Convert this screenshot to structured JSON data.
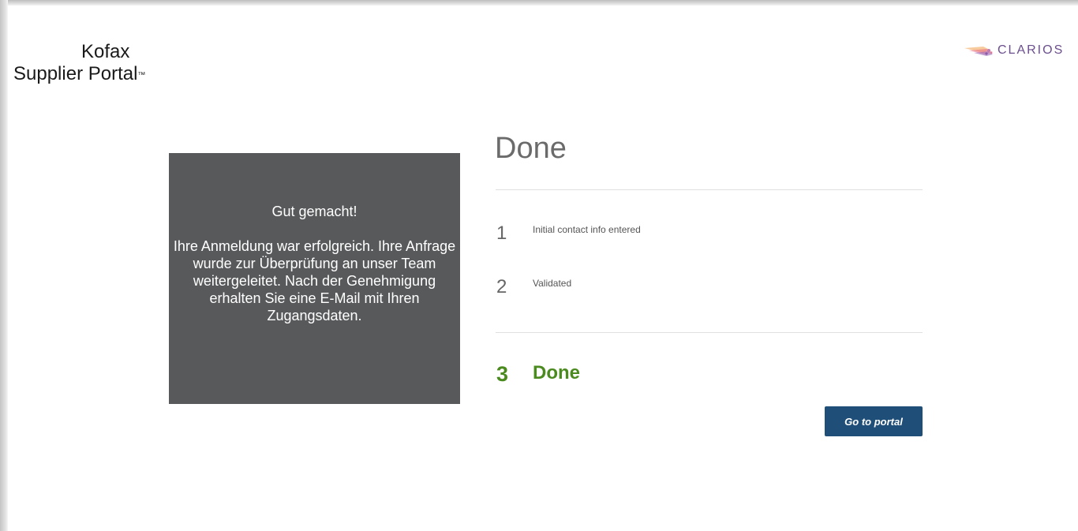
{
  "header": {
    "logo_line1": "Kofax",
    "logo_line2": "Supplier Portal",
    "logo_tm": "™",
    "brand_name": "CLARIOS",
    "brand_color": "#6b4f8e"
  },
  "message": {
    "title": "Gut gemacht!",
    "body": "Ihre Anmeldung war erfolgreich. Ihre Anfrage wurde zur Überprüfung an unser Team weitergeleitet. Nach der Genehmigung erhalten Sie eine E-Mail mit Ihren Zugangsdaten."
  },
  "wizard": {
    "title": "Done",
    "steps": [
      {
        "number": "1",
        "label": "Initial contact info entered",
        "state": "completed"
      },
      {
        "number": "2",
        "label": "Validated",
        "state": "completed"
      },
      {
        "number": "3",
        "label": "Done",
        "state": "current"
      }
    ],
    "current_color": "#4a8a1e",
    "button_label": "Go to portal",
    "button_color": "#1f4e79"
  }
}
